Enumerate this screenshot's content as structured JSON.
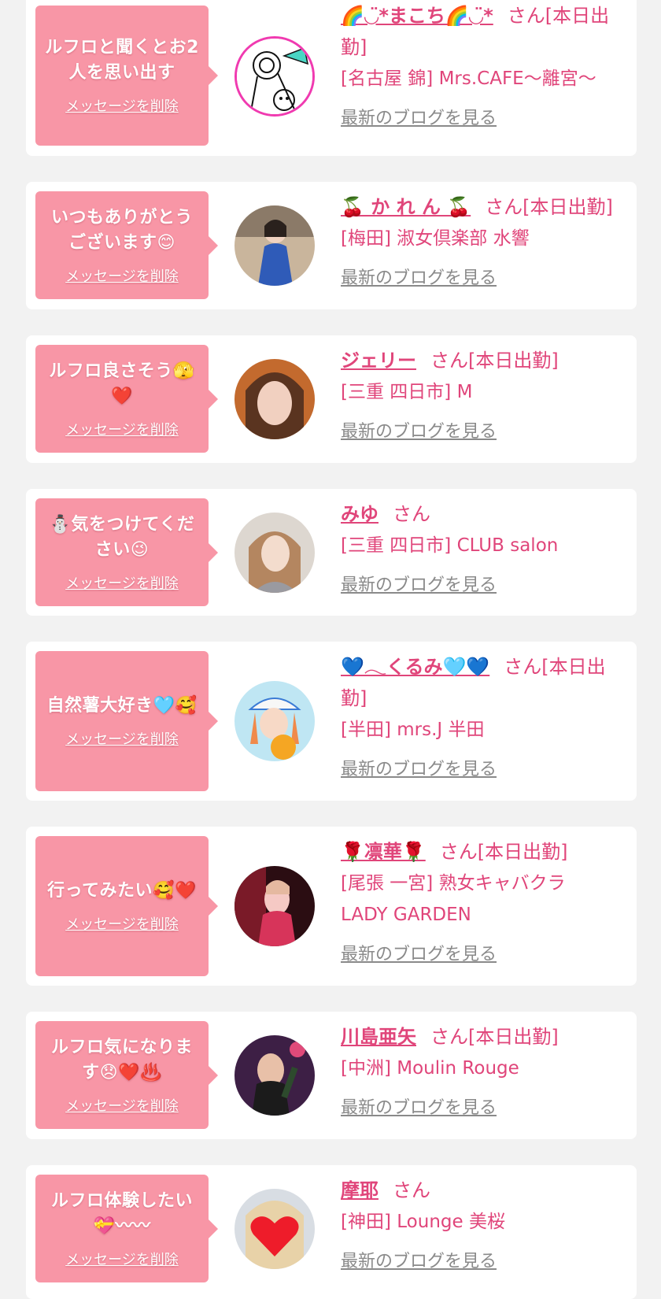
{
  "delete_label": "メッセージを削除",
  "blog_label": "最新のブログを見る",
  "colors": {
    "background": "#f2f2f2",
    "card": "#ffffff",
    "bubble": "#f896a6",
    "accent": "#e0457a",
    "link_gray": "#8a8a8a"
  },
  "messages": [
    {
      "message": "ルフロと聞くとお2人を思い出す",
      "name": "🌈◡̈*まこち🌈◡̈*",
      "suffix": "さん[本日出勤]",
      "shop": "[名古屋 錦] Mrs.CAFE～離宮～",
      "avatar_icon": "doodle-avatar"
    },
    {
      "message": "いつもありがとうございます😊",
      "name": "🍒 か れ ん 🍒",
      "suffix": "さん[本日出勤]",
      "shop": "[梅田] 淑女倶楽部 水響",
      "avatar_icon": "photo-avatar"
    },
    {
      "message": "ルフロ良さそう🫣❤️",
      "name": "ジェリー",
      "suffix": "さん[本日出勤]",
      "shop": "[三重 四日市] M",
      "avatar_icon": "photo-avatar"
    },
    {
      "message": "⛄気をつけてください😉",
      "name": "みゆ",
      "suffix": "さん",
      "shop": "[三重 四日市] CLUB salon",
      "avatar_icon": "photo-avatar"
    },
    {
      "message": "自然薯大好き🩵🥰",
      "name": "💙𓂃くるみ🩵💙",
      "suffix": "さん[本日出勤]",
      "shop": "[半田] mrs.J 半田",
      "avatar_icon": "photo-avatar"
    },
    {
      "message": "行ってみたい🥰❤️",
      "name": "🌹凛華🌹",
      "suffix": "さん[本日出勤]",
      "shop": "[尾張 一宮] 熟女キャバクラ LADY GARDEN",
      "avatar_icon": "photo-avatar"
    },
    {
      "message": "ルフロ気になります😞❤️♨️",
      "name": "川島亜矢",
      "suffix": "さん[本日出勤]",
      "shop": "[中洲] Moulin Rouge",
      "avatar_icon": "photo-avatar"
    },
    {
      "message": "ルフロ体験したい💝〰〰",
      "name": "摩耶",
      "suffix": "さん",
      "shop": "[神田] Lounge 美桜",
      "avatar_icon": "heart-cover-avatar"
    }
  ]
}
